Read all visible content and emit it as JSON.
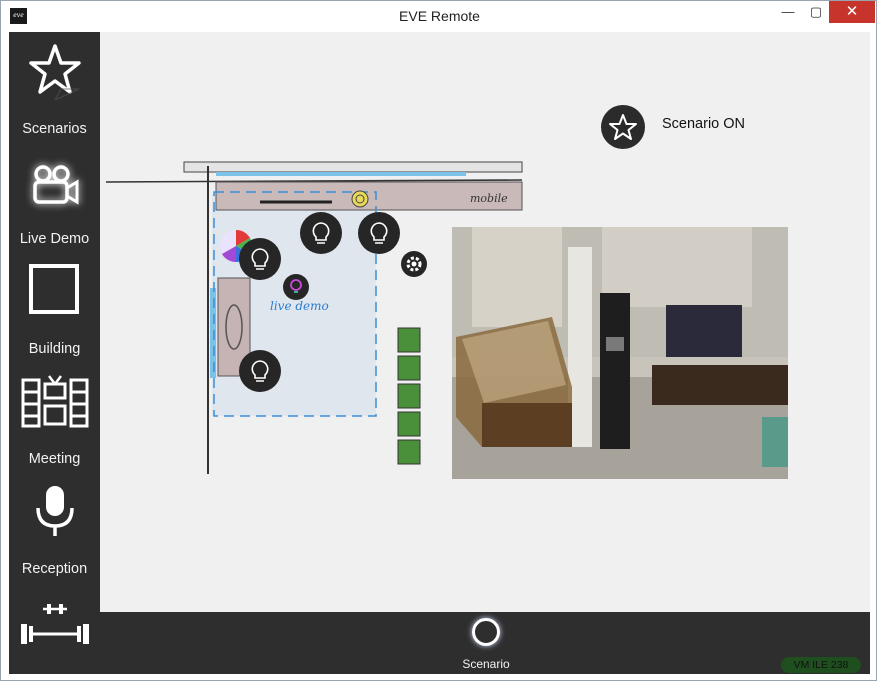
{
  "window": {
    "title": "EVE Remote",
    "minimize": "—",
    "maximize": "▢",
    "close": "✕"
  },
  "sidebar": {
    "items": [
      {
        "label": "Scenarios",
        "icon": "star-icon"
      },
      {
        "label": "Live Demo",
        "icon": "camera-icon"
      },
      {
        "label": "Building",
        "icon": "square-icon"
      },
      {
        "label": "Meeting",
        "icon": "meeting-icon"
      },
      {
        "label": "Reception",
        "icon": "microphone-icon"
      },
      {
        "label": "",
        "icon": "dumbbell-icon"
      }
    ]
  },
  "main": {
    "scenario_status": "Scenario ON",
    "floorplan": {
      "room_label": "live demo",
      "furniture_label": "mobile"
    }
  },
  "bottombar": {
    "scenario_label": "Scenario",
    "badge": "VM ILE 238"
  },
  "colors": {
    "sidebar_bg": "#2e2e2e",
    "main_bg": "#f0f0f0",
    "close_red": "#c7342b",
    "plan_blue": "#3a8fd6",
    "plant_green": "#4a8f3a"
  }
}
